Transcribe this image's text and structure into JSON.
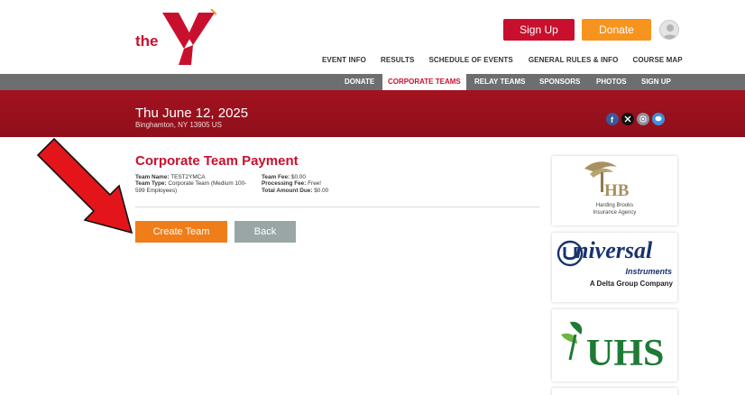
{
  "brand": {
    "logo_text": "the",
    "red": "#c8102e",
    "orange": "#f7941d",
    "purple": "#5c2d91"
  },
  "header": {
    "signup_label": "Sign Up",
    "donate_label": "Donate",
    "nav": [
      "EVENT INFO",
      "RESULTS",
      "SCHEDULE OF EVENTS",
      "GENERAL RULES & INFO",
      "COURSE MAP"
    ]
  },
  "subnav": {
    "items": [
      "DONATE",
      "CORPORATE TEAMS",
      "RELAY TEAMS",
      "SPONSORS",
      "PHOTOS",
      "SIGN UP"
    ],
    "active": "CORPORATE TEAMS"
  },
  "event": {
    "date": "Thu June 12, 2025",
    "location": "Binghamton, NY 13905 US"
  },
  "social_icons": [
    "facebook-icon",
    "x-icon",
    "instagram-icon",
    "chat-icon"
  ],
  "payment": {
    "title": "Corporate Team Payment",
    "team_name_label": "Team Name:",
    "team_name": "TEST2YMCA",
    "team_type_label": "Team Type:",
    "team_type_line1": "Corporate Team (Medium 100-",
    "team_type_line2": "599 Employees)",
    "team_fee_label": "Team Fee:",
    "team_fee": "$0.00",
    "processing_fee_label": "Processing Fee:",
    "processing_fee": "Free!",
    "total_label": "Total Amount Due:",
    "total": "$0.00",
    "create_label": "Create Team",
    "back_label": "Back"
  },
  "sponsors": {
    "hb": {
      "mark": "HB",
      "line1": "Harding Brooks",
      "line2": "Insurance Agency"
    },
    "universal": {
      "word": "niversal",
      "instruments": "Instruments",
      "tagline": "A Delta Group Company"
    },
    "uhs": {
      "word": "UHS"
    }
  }
}
